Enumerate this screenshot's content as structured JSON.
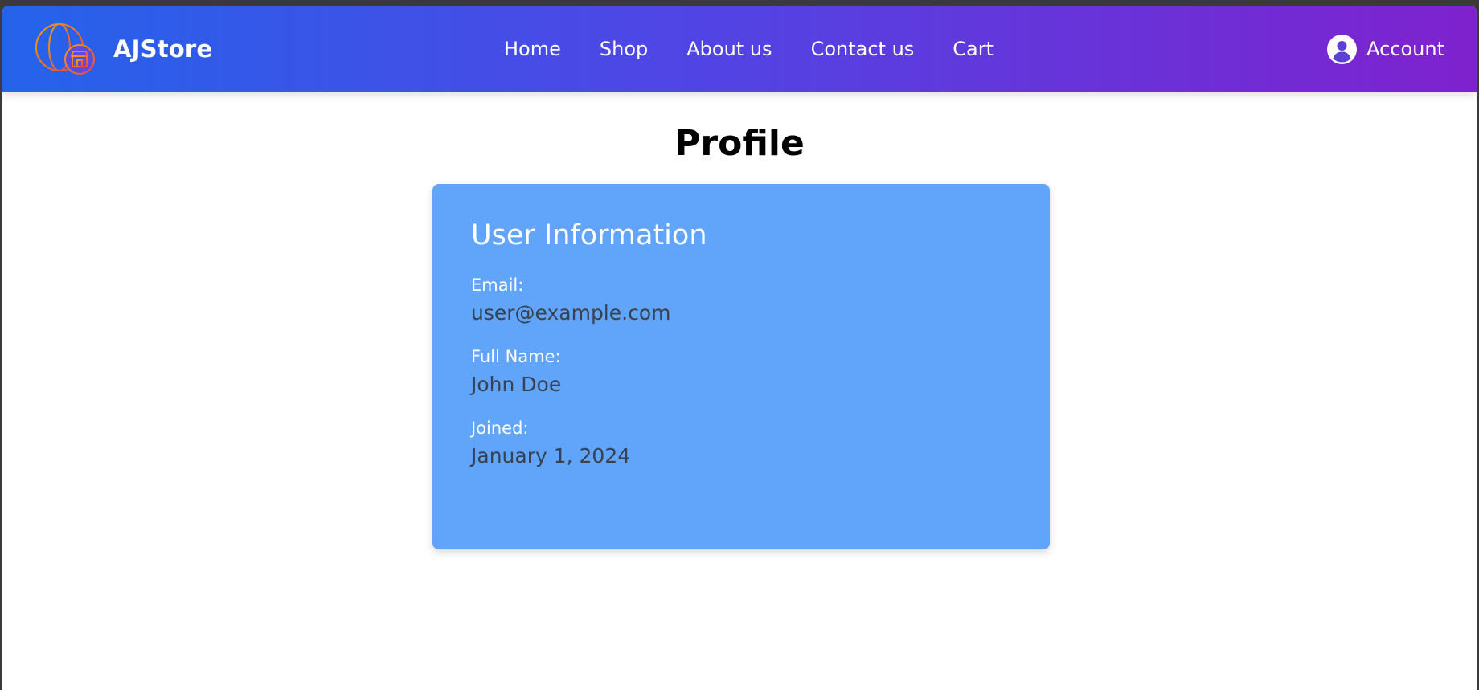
{
  "header": {
    "brand_name": "AJStore",
    "logo_icon": "globe-store-icon",
    "nav": [
      {
        "label": "Home"
      },
      {
        "label": "Shop"
      },
      {
        "label": "About us"
      },
      {
        "label": "Contact us"
      },
      {
        "label": "Cart"
      }
    ],
    "account_label": "Account",
    "account_icon": "user-circle-icon",
    "gradient_colors": [
      "#2563eb",
      "#4f46e5",
      "#7e22ce"
    ]
  },
  "main": {
    "page_title": "Profile",
    "card": {
      "title": "User Information",
      "background": "#60a5fa",
      "fields": [
        {
          "label": "Email:",
          "value": "user@example.com"
        },
        {
          "label": "Full Name:",
          "value": "John Doe"
        },
        {
          "label": "Joined:",
          "value": "January 1, 2024"
        }
      ]
    }
  }
}
